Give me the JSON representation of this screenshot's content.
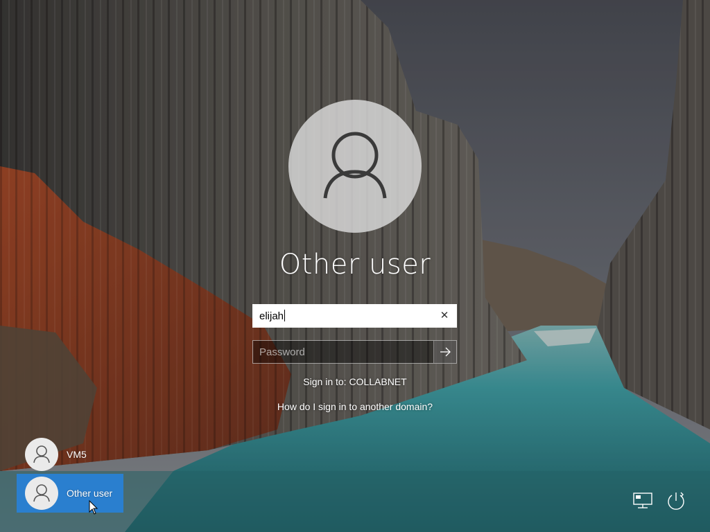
{
  "main": {
    "user_title": "Other user",
    "username": {
      "value": "elijah",
      "clear_icon": "close-icon"
    },
    "password": {
      "placeholder": "Password",
      "submit_icon": "arrow-right-icon"
    },
    "sign_in_to": "Sign in to: COLLABNET",
    "domain_help_link": "How do I sign in to another domain?"
  },
  "user_list": [
    {
      "label": "VM5",
      "icon": "person-icon",
      "selected": false
    },
    {
      "label": "Other user",
      "icon": "person-icon",
      "selected": true
    }
  ],
  "corner": {
    "network_icon": "network-icon",
    "power_icon": "power-icon"
  },
  "colors": {
    "selected_user_bg": "#2a7fcf",
    "water": "#3e8f96",
    "sky": "#5c5f68"
  }
}
